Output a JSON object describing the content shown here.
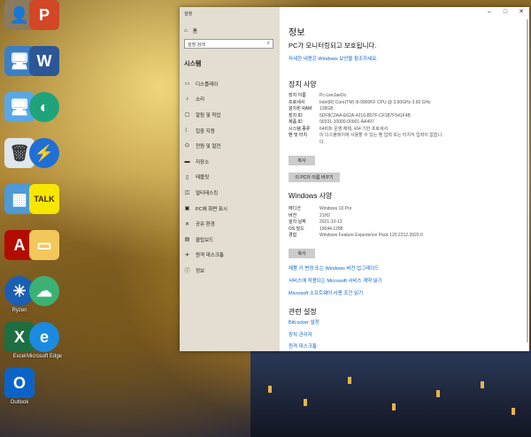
{
  "desktop": {
    "icons": [
      {
        "label": ""
      },
      {
        "label": ""
      },
      {
        "label": ""
      },
      {
        "label": ""
      },
      {
        "label": ""
      },
      {
        "label": ""
      },
      {
        "label": ""
      },
      {
        "label": ""
      },
      {
        "label": ""
      },
      {
        "label": ""
      },
      {
        "label": ""
      },
      {
        "label": ""
      },
      {
        "label": "Ryzen"
      },
      {
        "label": ""
      },
      {
        "label": "Excel"
      },
      {
        "label": "Microsoft Edge"
      },
      {
        "label": "Outlook"
      }
    ],
    "kakao_text": "TALK"
  },
  "settings": {
    "app_title": "설정",
    "home": "홈",
    "search_placeholder": "설정 검색",
    "system_header": "시스템",
    "nav": [
      {
        "label": "디스플레이",
        "icon": "display-icon"
      },
      {
        "label": "소리",
        "icon": "sound-icon"
      },
      {
        "label": "알림 및 작업",
        "icon": "notification-icon"
      },
      {
        "label": "집중 지원",
        "icon": "focus-icon"
      },
      {
        "label": "전원 및 절전",
        "icon": "power-icon"
      },
      {
        "label": "저장소",
        "icon": "storage-icon"
      },
      {
        "label": "태블릿",
        "icon": "tablet-icon"
      },
      {
        "label": "멀티태스킹",
        "icon": "multitask-icon"
      },
      {
        "label": "PC에 화면 표시",
        "icon": "project-icon"
      },
      {
        "label": "공유 환경",
        "icon": "share-icon"
      },
      {
        "label": "클립보드",
        "icon": "clipboard-icon"
      },
      {
        "label": "원격 데스크톱",
        "icon": "remote-icon"
      },
      {
        "label": "정보",
        "icon": "info-icon"
      }
    ],
    "page_title": "정보",
    "protection_text": "PC가 모니터링되고 보호됩니다.",
    "security_link": "자세한 내용은 Windows 보안을 참조하세요.",
    "device_spec": {
      "title": "장치 사양",
      "rows": [
        {
          "k": "장치 이름",
          "v": "Pc-LeeJaeDo"
        },
        {
          "k": "프로세서",
          "v": "Intel(R) Core(TM) i9-9900KF CPU @ 3.60GHz   3.60 GHz"
        },
        {
          "k": "설치된 RAM",
          "v": "128GB"
        },
        {
          "k": "장치 ID",
          "v": "5DF8C2AA-E62A-4216-B57F-CF387F541F4B"
        },
        {
          "k": "제품 ID",
          "v": "00331-10000-00001-AA497"
        },
        {
          "k": "시스템 종류",
          "v": "64비트 운영 체제, x64 기반 프로세서"
        },
        {
          "k": "펜 및 터치",
          "v": "이 디스플레이에 사용할 수 있는 펜 입력 또는 터치식 입력이 없습니다."
        }
      ],
      "copy_button": "복사",
      "rename_button": "이 PC의 이름 바꾸기"
    },
    "windows_spec": {
      "title": "Windows 사양",
      "rows": [
        {
          "k": "에디션",
          "v": "Windows 10 Pro"
        },
        {
          "k": "버전",
          "v": "21H2"
        },
        {
          "k": "설치 날짜",
          "v": "2021-10-13"
        },
        {
          "k": "OS 빌드",
          "v": "19044.1288"
        },
        {
          "k": "경험",
          "v": "Windows Feature Experience Pack 120.2212.3920.0"
        }
      ],
      "copy_button": "복사",
      "links": [
        "제품 키 변경 또는 Windows 버전 업그레이드",
        "서비스에 적용되는 Microsoft 서비스 계약 읽기",
        "Microsoft 소프트웨어 사용 조건 읽기"
      ]
    },
    "related": {
      "title": "관련 설정",
      "links": [
        "BitLocker 설정",
        "장치 관리자",
        "원격 데스크톱"
      ]
    }
  },
  "colors": {
    "link": "#0a64c8",
    "sidebar": "#e1dccd"
  }
}
